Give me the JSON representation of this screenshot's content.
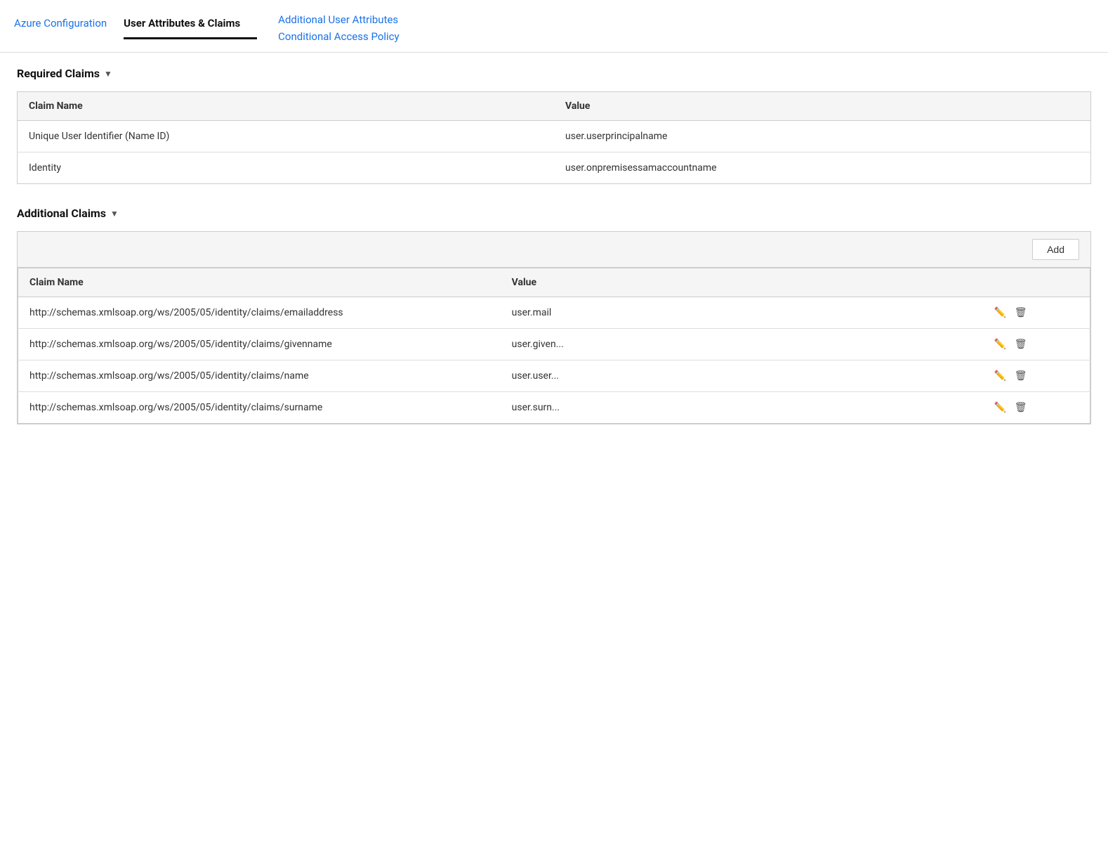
{
  "nav": {
    "tabs": [
      {
        "id": "azure-config",
        "label": "Azure Configuration",
        "active": false
      },
      {
        "id": "user-attributes",
        "label": "User Attributes & Claims",
        "active": true
      }
    ],
    "right_links": [
      {
        "id": "additional-user-attributes",
        "label": "Additional User Attributes"
      },
      {
        "id": "conditional-access-policy",
        "label": "Conditional Access Policy"
      }
    ]
  },
  "required_claims": {
    "section_title": "Required Claims",
    "columns": {
      "name": "Claim Name",
      "value": "Value"
    },
    "rows": [
      {
        "name": "Unique User Identifier (Name ID)",
        "value": "user.userprincipalname"
      },
      {
        "name": "Identity",
        "value": "user.onpremisessamaccountname"
      }
    ]
  },
  "additional_claims": {
    "section_title": "Additional Claims",
    "add_button_label": "Add",
    "columns": {
      "name": "Claim Name",
      "value": "Value"
    },
    "rows": [
      {
        "name": "http://schemas.xmlsoap.org/ws/2005/05/identity/claims/emailaddress",
        "value": "user.mail"
      },
      {
        "name": "http://schemas.xmlsoap.org/ws/2005/05/identity/claims/givenname",
        "value": "user.given..."
      },
      {
        "name": "http://schemas.xmlsoap.org/ws/2005/05/identity/claims/name",
        "value": "user.user..."
      },
      {
        "name": "http://schemas.xmlsoap.org/ws/2005/05/identity/claims/surname",
        "value": "user.surn..."
      }
    ]
  },
  "icons": {
    "chevron_down": "▼",
    "edit": "✎",
    "delete": "🗑"
  }
}
